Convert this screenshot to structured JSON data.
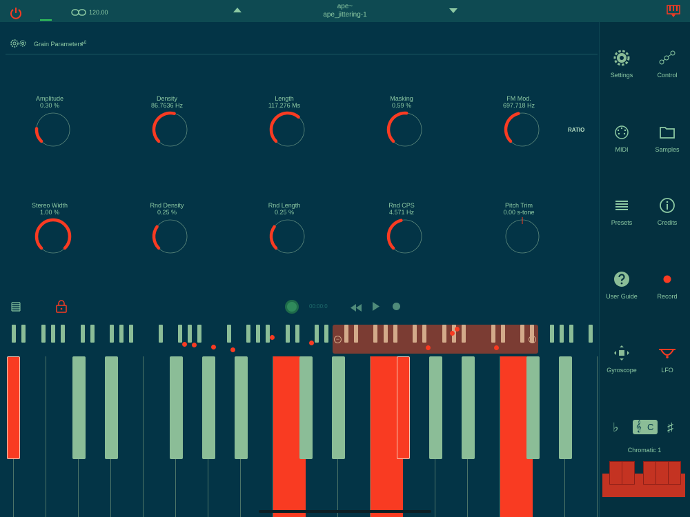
{
  "topbar": {
    "tempo": "120.00",
    "preset_line1": "ape~",
    "preset_line2": "ape_jittering-1"
  },
  "section": {
    "title": "Grain Parameters"
  },
  "knobs_row1": [
    {
      "name": "Amplitude",
      "value": "0.30 %",
      "level": 0.18
    },
    {
      "name": "Density",
      "value": "86.7636 Hz",
      "level": 0.55
    },
    {
      "name": "Length",
      "value": "117.276 Ms",
      "level": 0.65
    },
    {
      "name": "Masking",
      "value": "0.59 %",
      "level": 0.52
    },
    {
      "name": "FM Mod.",
      "value": "697.718 Hz",
      "level": 0.45
    }
  ],
  "ratio_label": "RATIO",
  "knobs_row2": [
    {
      "name": "Stereo Width",
      "value": "1.00 %",
      "level": 1.0
    },
    {
      "name": "Rnd Density",
      "value": "0.25 %",
      "level": 0.3
    },
    {
      "name": "Rnd Length",
      "value": "0.25 %",
      "level": 0.3
    },
    {
      "name": "Rnd CPS",
      "value": "4.571 Hz",
      "level": 0.45
    },
    {
      "name": "Pitch Trim",
      "value": "0.00 s-tone",
      "level": 0.5
    }
  ],
  "transport": {
    "time": "00:00:0"
  },
  "sidebar": {
    "items": [
      {
        "label": "Settings",
        "icon": "gear-icon"
      },
      {
        "label": "Control",
        "icon": "nodes-icon"
      },
      {
        "label": "MIDI",
        "icon": "midi-icon"
      },
      {
        "label": "Samples",
        "icon": "folder-icon"
      },
      {
        "label": "Presets",
        "icon": "list-icon"
      },
      {
        "label": "Credits",
        "icon": "info-icon"
      },
      {
        "label": "User Guide",
        "icon": "question-icon"
      },
      {
        "label": "Record",
        "icon": "record-icon"
      },
      {
        "label": "Gyroscope",
        "icon": "gyroscope-icon"
      },
      {
        "label": "LFO",
        "icon": "lfo-icon"
      }
    ],
    "flat": "♭",
    "key": "C",
    "sharp": "♯",
    "scale": "Chromatic 1"
  },
  "colors": {
    "accent": "#f93b22",
    "text": "#8cc9a3",
    "background": "#033446"
  }
}
